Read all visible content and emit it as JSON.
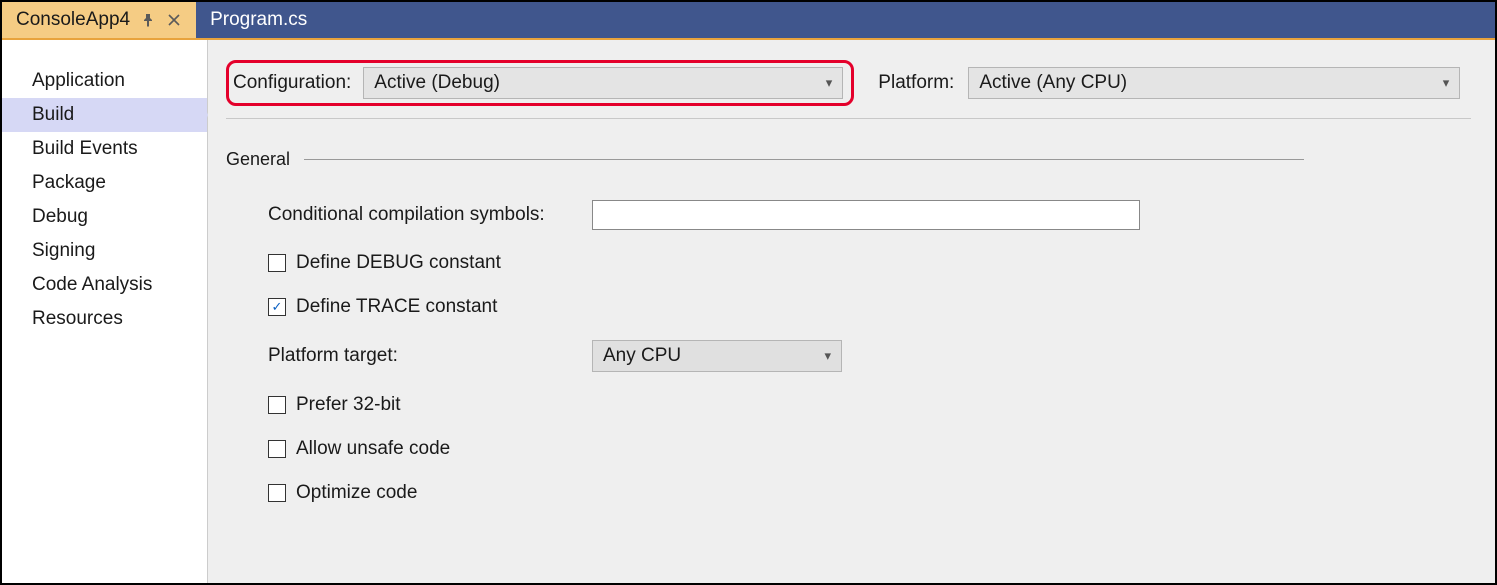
{
  "tabs": {
    "active": {
      "label": "ConsoleApp4"
    },
    "other": {
      "label": "Program.cs"
    }
  },
  "sidebar": {
    "items": [
      {
        "label": "Application"
      },
      {
        "label": "Build"
      },
      {
        "label": "Build Events"
      },
      {
        "label": "Package"
      },
      {
        "label": "Debug"
      },
      {
        "label": "Signing"
      },
      {
        "label": "Code Analysis"
      },
      {
        "label": "Resources"
      }
    ],
    "selected_index": 1
  },
  "top": {
    "configuration_label": "Configuration:",
    "configuration_value": "Active (Debug)",
    "platform_label": "Platform:",
    "platform_value": "Active (Any CPU)"
  },
  "section": {
    "title": "General"
  },
  "form": {
    "symbols_label": "Conditional compilation symbols:",
    "symbols_value": "",
    "define_debug_label": "Define DEBUG constant",
    "define_debug_checked": false,
    "define_trace_label": "Define TRACE constant",
    "define_trace_checked": true,
    "platform_target_label": "Platform target:",
    "platform_target_value": "Any CPU",
    "prefer32_label": "Prefer 32-bit",
    "prefer32_checked": false,
    "allow_unsafe_label": "Allow unsafe code",
    "allow_unsafe_checked": false,
    "optimize_label": "Optimize code",
    "optimize_checked": false
  }
}
